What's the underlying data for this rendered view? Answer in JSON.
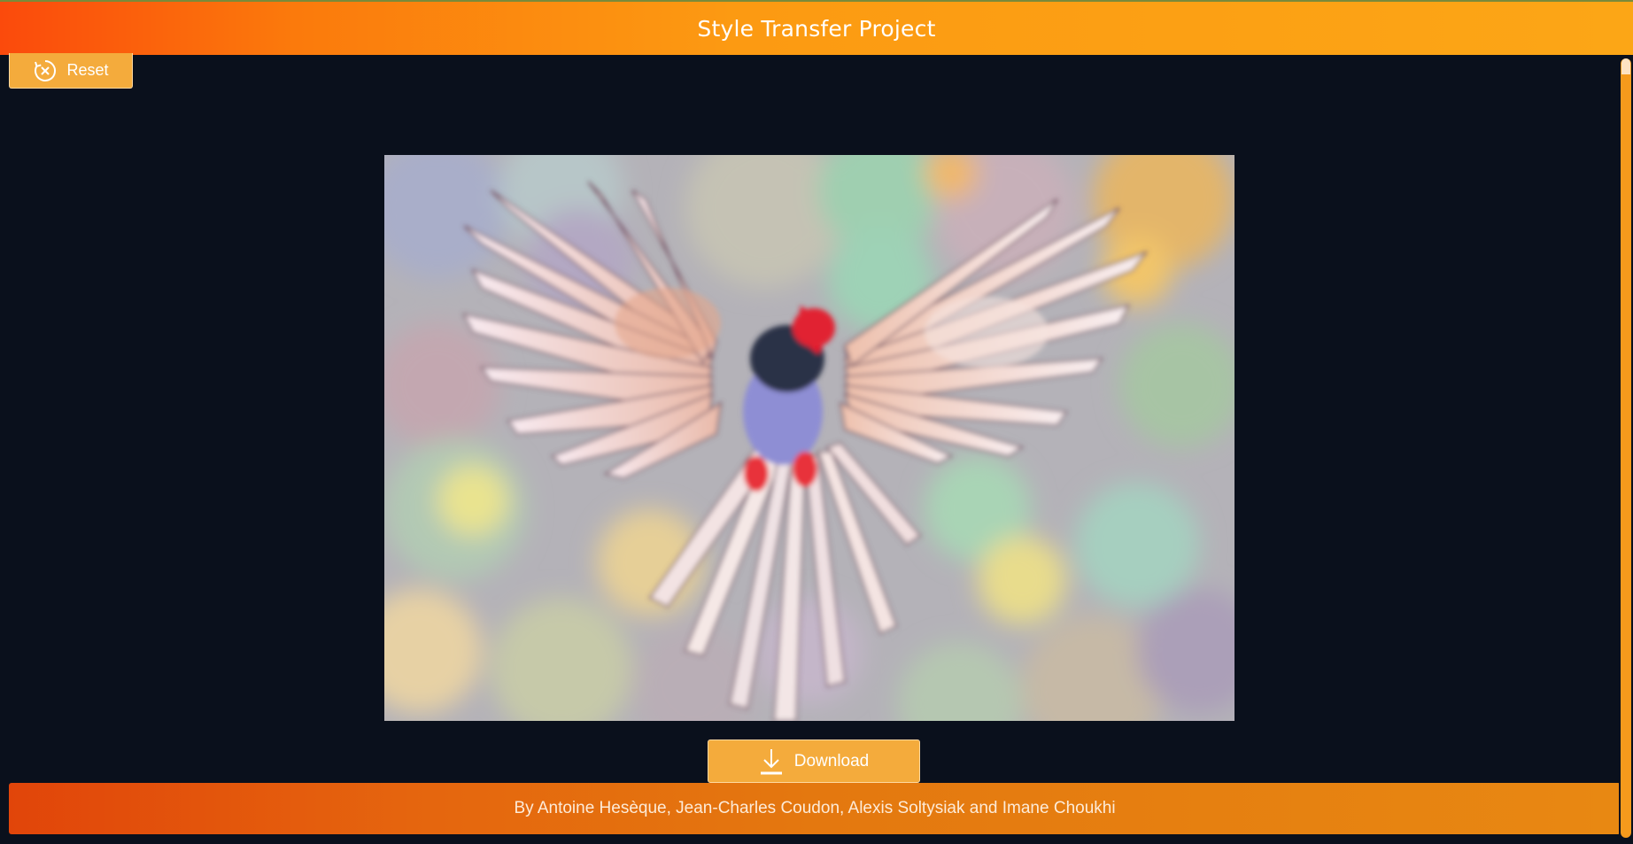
{
  "header": {
    "title": "Style Transfer Project"
  },
  "toolbar": {
    "reset_label": "Reset",
    "reset_icon": "close-circle-icon"
  },
  "main": {
    "image_alt": "Stylized painting of a bird with spread wings"
  },
  "actions": {
    "download_label": "Download",
    "download_icon": "download-icon"
  },
  "footer": {
    "credits": "By Antoine Hesèque, Jean-Charles Coudon, Alexis Soltysiak and Imane Choukhi"
  },
  "colors": {
    "background": "#0a101c",
    "accent": "#f4ab3c",
    "header_start": "#fb4a0c",
    "header_end": "#fca616"
  }
}
